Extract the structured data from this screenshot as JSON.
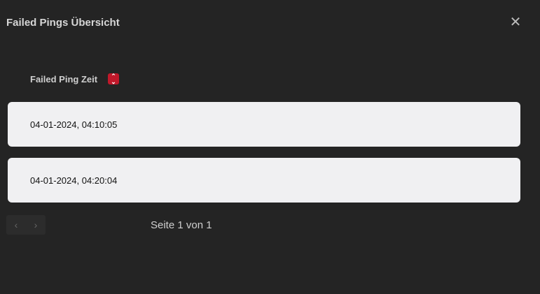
{
  "dialog": {
    "title": "Failed Pings Übersicht",
    "close_icon": "close-icon"
  },
  "table": {
    "column_header": "Failed Ping Zeit",
    "sort_icon": "sort-icon",
    "rows": [
      "04-01-2024, 04:10:05",
      "04-01-2024, 04:20:04"
    ]
  },
  "pagination": {
    "prev": "‹",
    "next": "›",
    "page_text": "Seite 1 von 1"
  },
  "colors": {
    "accent": "#c0182a",
    "background": "#242424",
    "row": "#f0f0f2"
  }
}
